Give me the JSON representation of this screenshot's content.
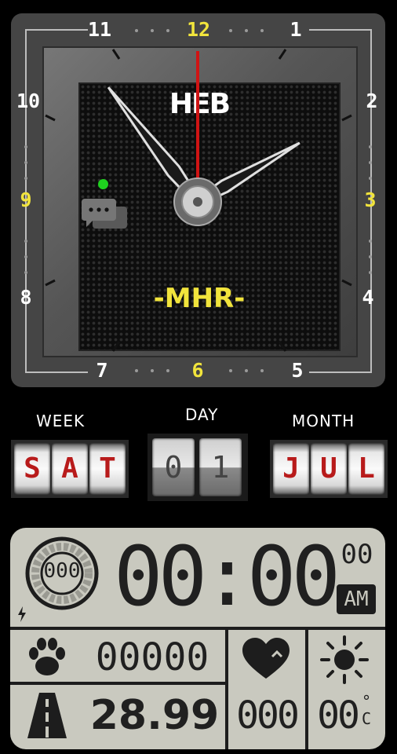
{
  "dial": {
    "numerals": [
      "12",
      "1",
      "2",
      "3",
      "4",
      "5",
      "6",
      "7",
      "8",
      "9",
      "10",
      "11"
    ],
    "accent_numerals": [
      "12",
      "3",
      "6",
      "9"
    ],
    "brand_top": "HEB",
    "brand_bottom": "-MHR-",
    "status_dot_color": "#1fd21f",
    "accent_color": "#f1e43c",
    "second_hand_color": "#d01414",
    "messages_icon": "chat-bubbles-icon"
  },
  "date": {
    "week_label": "WEEK",
    "day_label": "DAY",
    "month_label": "MONTH",
    "week_letters": [
      "S",
      "A",
      "T"
    ],
    "day_digits": [
      "0",
      "1"
    ],
    "month_letters": [
      "J",
      "U",
      "L"
    ]
  },
  "lcd": {
    "battery": "000",
    "time": "00:00",
    "seconds": "00",
    "ampm": "AM",
    "steps_icon": "paw-icon",
    "steps": "00000",
    "heart_icon": "heart-icon",
    "heart_rate": "000",
    "weather_icon": "sun-icon",
    "temperature": "00",
    "temperature_unit": "°C",
    "distance_icon": "road-icon",
    "distance": "28.99"
  }
}
